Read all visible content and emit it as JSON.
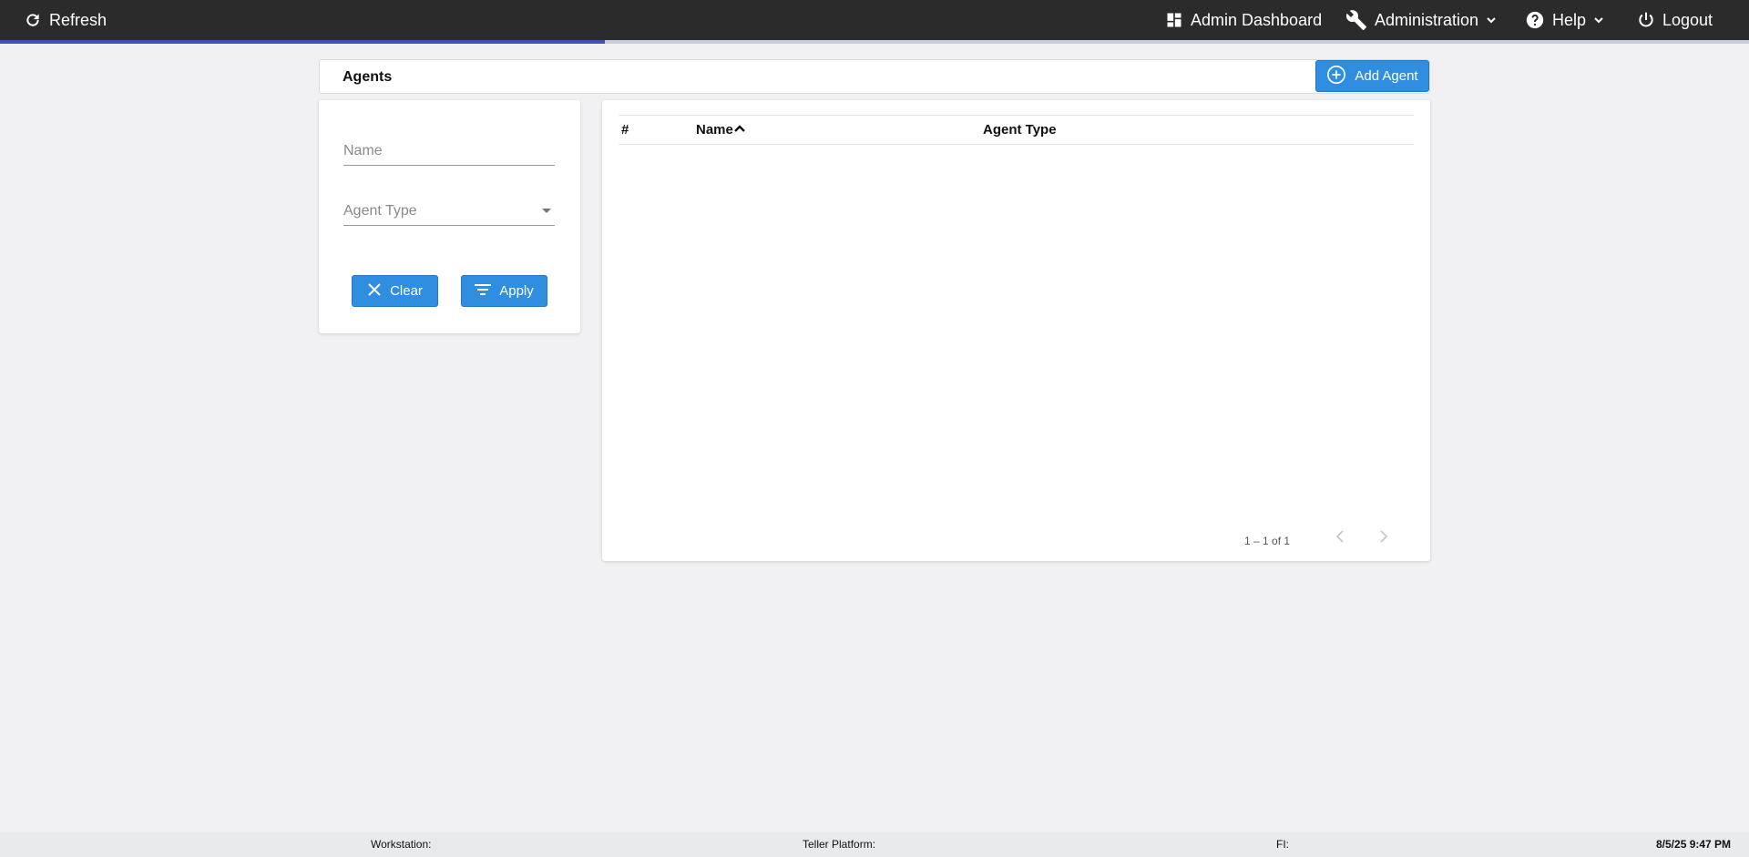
{
  "topbar": {
    "refresh_label": "Refresh",
    "admin_dashboard_label": "Admin Dashboard",
    "administration_label": "Administration",
    "help_label": "Help",
    "logout_label": "Logout",
    "background_color": "#2b2b2b",
    "progress_color": "#3f51b5",
    "progress_fraction": 0.346
  },
  "page": {
    "title": "Agents",
    "add_button_label": "Add Agent"
  },
  "filters": {
    "name_placeholder": "Name",
    "agent_type_placeholder": "Agent Type",
    "clear_label": "Clear",
    "apply_label": "Apply"
  },
  "table": {
    "columns": [
      "#",
      "Name",
      "Agent Type"
    ],
    "sort_column": "Name",
    "sort_direction": "ascending",
    "rows": [],
    "pagination_text": "1 – 1 of 1"
  },
  "footer": {
    "workstation_label": "Workstation:",
    "teller_platform_label": "Teller Platform:",
    "fi_label": "FI:",
    "datetime": "8/5/25 9:47 PM"
  },
  "colors": {
    "accent_button": "#2f8ee0",
    "page_background": "#f1f1f3"
  },
  "icons": {
    "refresh": "refresh-icon",
    "admin_dashboard": "dashboard-icon",
    "administration": "wrench-icon",
    "help": "help-circle-icon",
    "logout": "power-icon",
    "add_agent": "plus-circle-icon",
    "clear": "close-icon",
    "apply": "filter-icon"
  }
}
